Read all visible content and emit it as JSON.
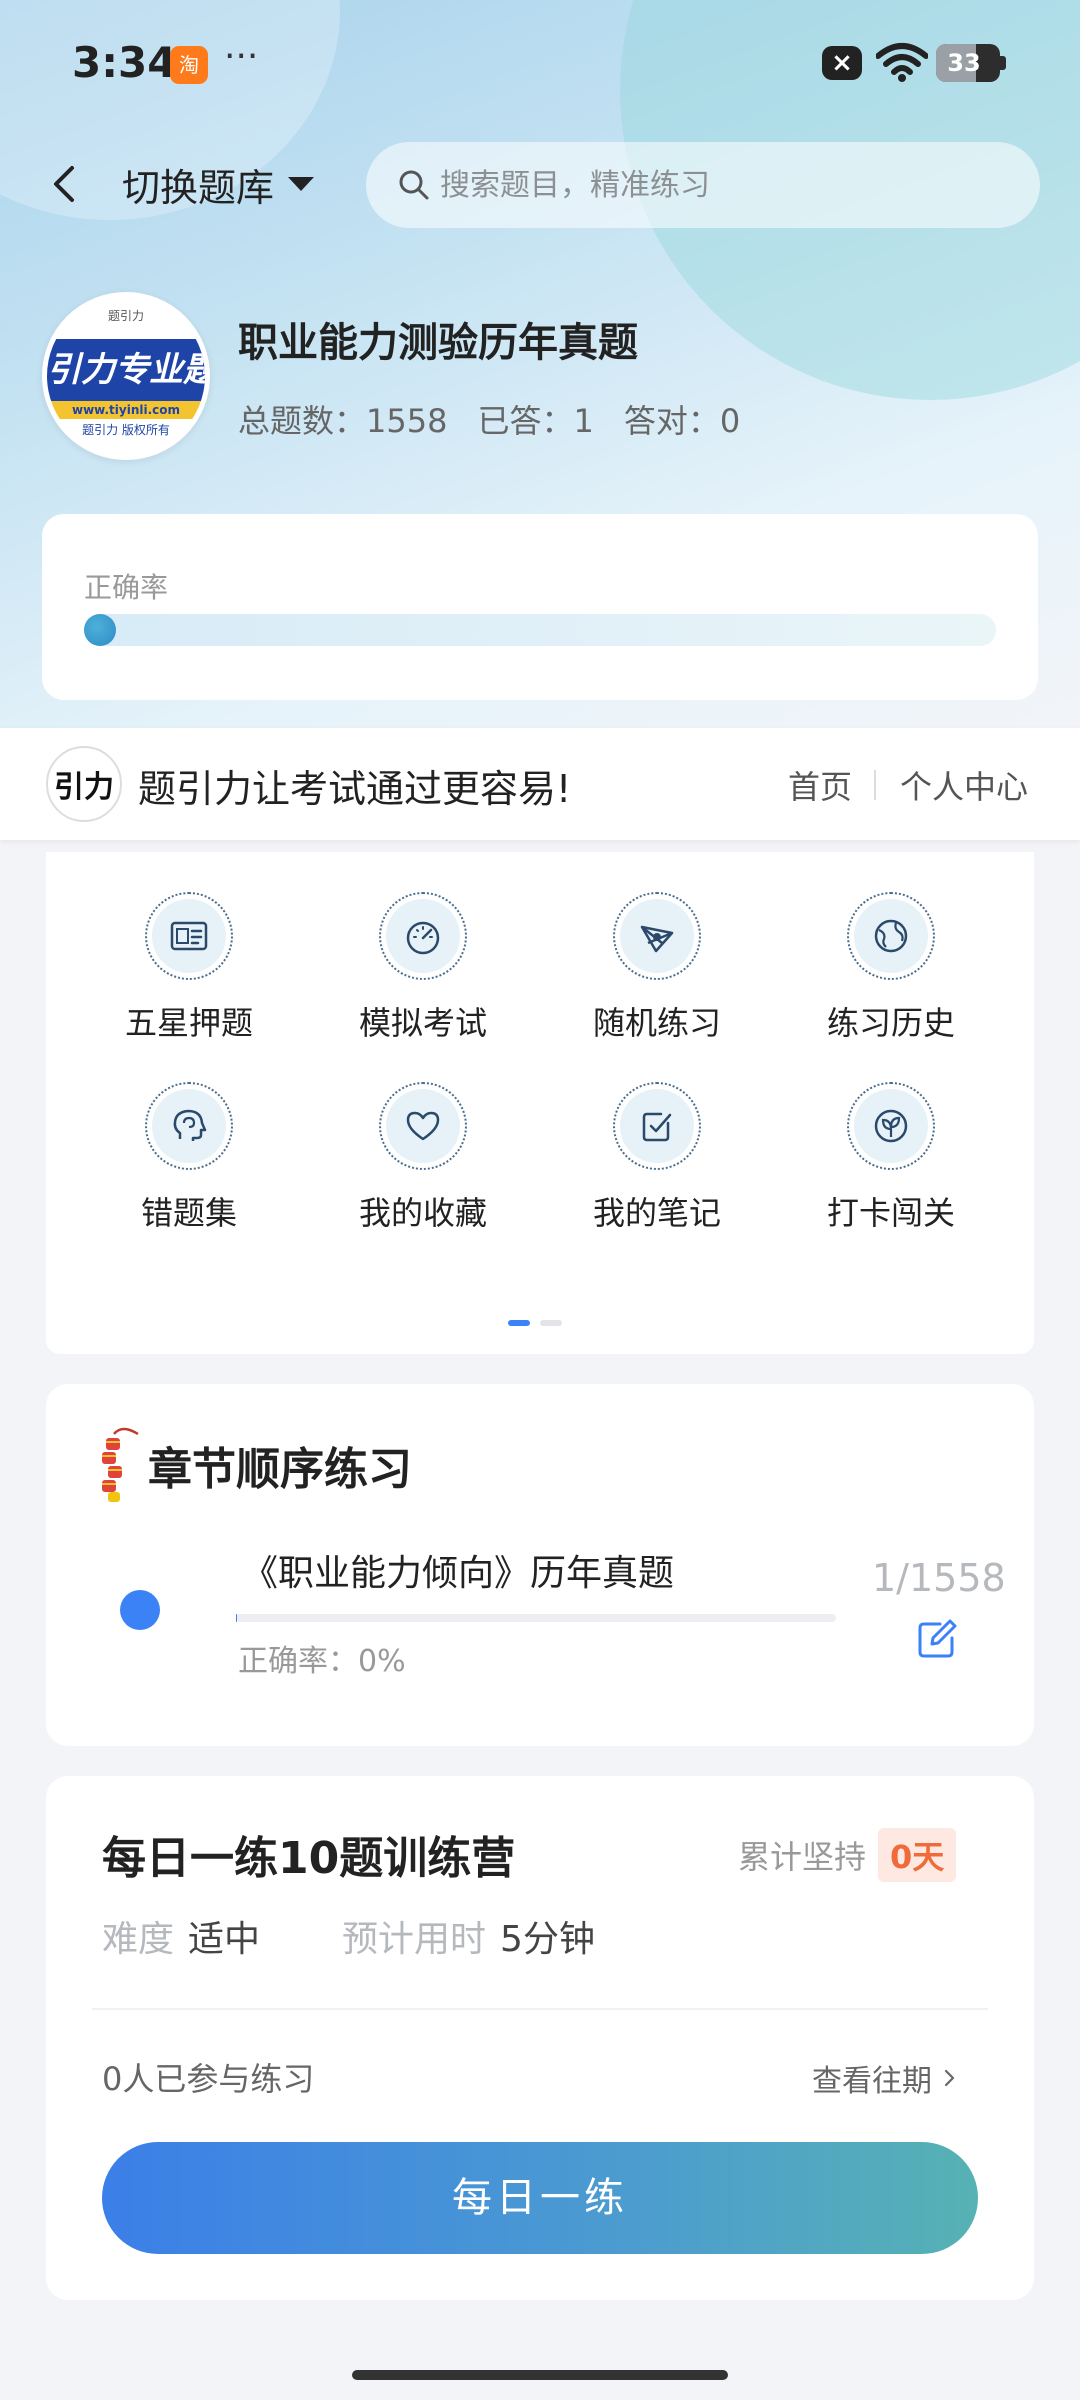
{
  "status_bar": {
    "time": "3:34",
    "app_badge": "淘",
    "more": "···",
    "battery": "33",
    "icons": [
      "app-icon",
      "close-icon",
      "wifi-icon",
      "battery-icon"
    ]
  },
  "header": {
    "switch_label": "切换题库",
    "search_placeholder": "搜索题目，精准练习"
  },
  "bank": {
    "logo_band_text": "引力专业题",
    "logo_url_text": "www.tiyinli.com",
    "logo_copy_text": "题引力 版权所有",
    "logo_mini_text": "题引力",
    "title": "职业能力测验历年真题",
    "total": "总题数：1558",
    "answered": "已答：1",
    "correct": "答对：0"
  },
  "accuracy": {
    "label": "正确率",
    "value_fraction": 0.0
  },
  "promo": {
    "logo_text": "引力",
    "slogan": "题引力让考试通过更容易!",
    "home": "首页",
    "user_center": "个人中心"
  },
  "features": [
    {
      "label": "五星押题",
      "icon": "id-card-icon"
    },
    {
      "label": "模拟考试",
      "icon": "gauge-icon"
    },
    {
      "label": "随机练习",
      "icon": "shuffle-icon"
    },
    {
      "label": "练习历史",
      "icon": "globe-icon"
    },
    {
      "label": "错题集",
      "icon": "head-icon"
    },
    {
      "label": "我的收藏",
      "icon": "heart-icon"
    },
    {
      "label": "我的笔记",
      "icon": "note-check-icon"
    },
    {
      "label": "打卡闯关",
      "icon": "sprout-icon"
    }
  ],
  "pager": {
    "pages": 2,
    "current": 0
  },
  "chapter": {
    "title": "章节顺序练习",
    "name": "《职业能力倾向》历年真题",
    "accuracy": "正确率：0%",
    "progress": "1/1558",
    "progress_fraction": 0.0006
  },
  "daily": {
    "title": "每日一练10题训练营",
    "streak_label": "累计坚持",
    "streak_value": "0天",
    "difficulty_label": "难度",
    "difficulty_value": "适中",
    "time_label": "预计用时",
    "time_value": "5分钟",
    "participants": "0人已参与练习",
    "history": "查看往期",
    "button": "每日一练"
  },
  "colors": {
    "accent": "#3b82f6",
    "streak": "#f06a3a",
    "button_start": "#3b7fe8",
    "button_end": "#56b2b4"
  }
}
